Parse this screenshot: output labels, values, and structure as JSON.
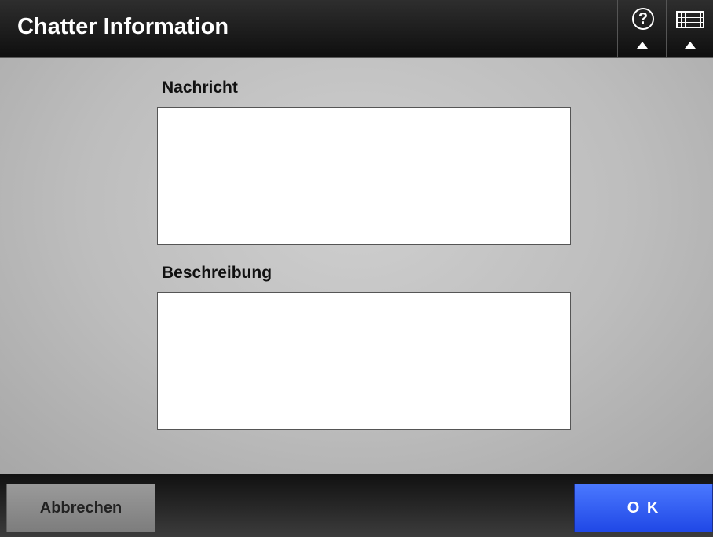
{
  "header": {
    "title": "Chatter Information",
    "help_icon": "help-question-icon",
    "keyboard_icon": "keyboard-icon"
  },
  "form": {
    "message_label": "Nachricht",
    "message_value": "",
    "description_label": "Beschreibung",
    "description_value": ""
  },
  "footer": {
    "cancel_label": "Abbrechen",
    "ok_label": "O K"
  },
  "colors": {
    "ok_button": "#2a55f0",
    "cancel_button": "#8a8a8a",
    "titlebar": "#1a1a1a"
  }
}
